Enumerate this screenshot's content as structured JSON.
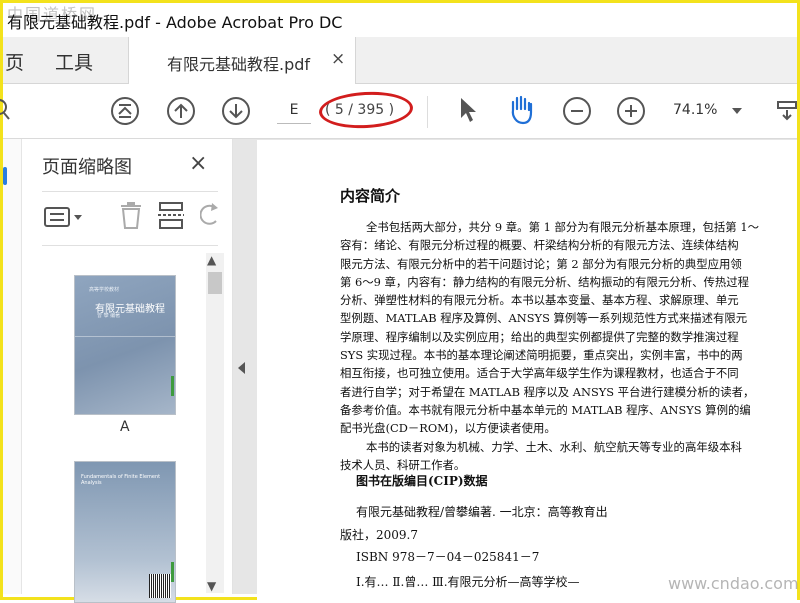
{
  "window": {
    "title": "有限元基础教程.pdf - Adobe Acrobat Pro DC",
    "watermark_top_left": "中国道桥网"
  },
  "tabs": {
    "home": "页",
    "tools": "工具",
    "document": "有限元基础教程.pdf",
    "close": "×"
  },
  "toolbar": {
    "page_input": "E",
    "page_count": "( 5 / 395 )",
    "zoom": "74.1%",
    "accent": "#2a7de1",
    "annotation_color": "#d21d1d"
  },
  "thumbnails": {
    "title": "页面缩略图",
    "close": "×",
    "items": [
      {
        "label": "A",
        "cover_series": "高等学校教材",
        "cover_title": "有限元基础教程",
        "cover_author": "曾 攀 编著"
      },
      {
        "label": "",
        "cover_title": "Fundamentals of Finite Element Analysis"
      }
    ]
  },
  "document": {
    "heading": "内容简介",
    "paragraph_lines": [
      "全书包括两大部分，共分 9 章。第 1 部分为有限元分析基本原理，包括第 1～",
      "容有：绪论、有限元分析过程的概要、杆梁结构分析的有限元方法、连续体结构",
      "限元方法、有限元分析中的若干问题讨论；第 2 部分为有限元分析的典型应用领",
      "第 6～9 章，内容有：静力结构的有限元分析、结构振动的有限元分析、传热过程",
      "分析、弹塑性材料的有限元分析。本书以基本变量、基本方程、求解原理、单元",
      "型例题、MATLAB 程序及算例、ANSYS 算例等一系列规范性方式来描述有限元",
      "学原理、程序编制以及实例应用；给出的典型实例都提供了完整的数学推演过程",
      "SYS 实现过程。本书的基本理论阐述简明扼要，重点突出，实例丰富，书中的两",
      "相互衔接，也可独立使用。适合于大学高年级学生作为课程教材，也适合于不同",
      "者进行自学；对于希望在 MATLAB 程序以及 ANSYS 平台进行建模分析的读者，",
      "备参考价值。本书就有限元分析中基本单元的 MATLAB 程序、ANSYS 算例的编",
      "配书光盘(CD－ROM)，以方便读者使用。",
      "本书的读者对象为机械、力学、土木、水利、航空航天等专业的高年级本科",
      "技术人员、科研工作者。"
    ],
    "cip_heading": "图书在版编目(CIP)数据",
    "cip_lines": [
      "有限元基础教程/曾攀编著. 一北京：高等教育出",
      "版社，2009.7",
      "ISBN 978－7－04－025841－7",
      "Ⅰ.有…  Ⅱ.曾…  Ⅲ.有限元分析—高等学校—"
    ],
    "watermark_bottom_right": "www.cndao.com"
  }
}
